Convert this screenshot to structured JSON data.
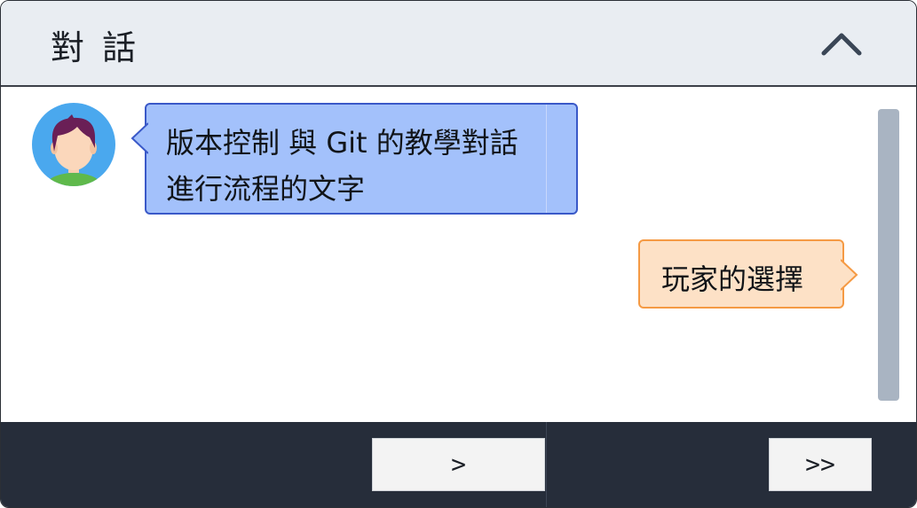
{
  "header": {
    "title": "對 話",
    "collapse_icon": "chevron-up-icon"
  },
  "dialogue": {
    "npc": {
      "avatar_icon": "boy-avatar-icon",
      "line1": "版本控制 與 Git 的教學對話",
      "line2": "進行流程的文字"
    },
    "player_choice": "玩家的選擇"
  },
  "footer": {
    "next_label": ">",
    "skip_label": ">>"
  },
  "colors": {
    "header_bg": "#e9edf2",
    "footer_bg": "#262d3a",
    "npc_bubble": "#a3c1fb",
    "npc_border": "#3a59c8",
    "player_bubble": "#fde1c6",
    "player_border": "#f59a44",
    "scrollbar": "#a9b4c2"
  }
}
